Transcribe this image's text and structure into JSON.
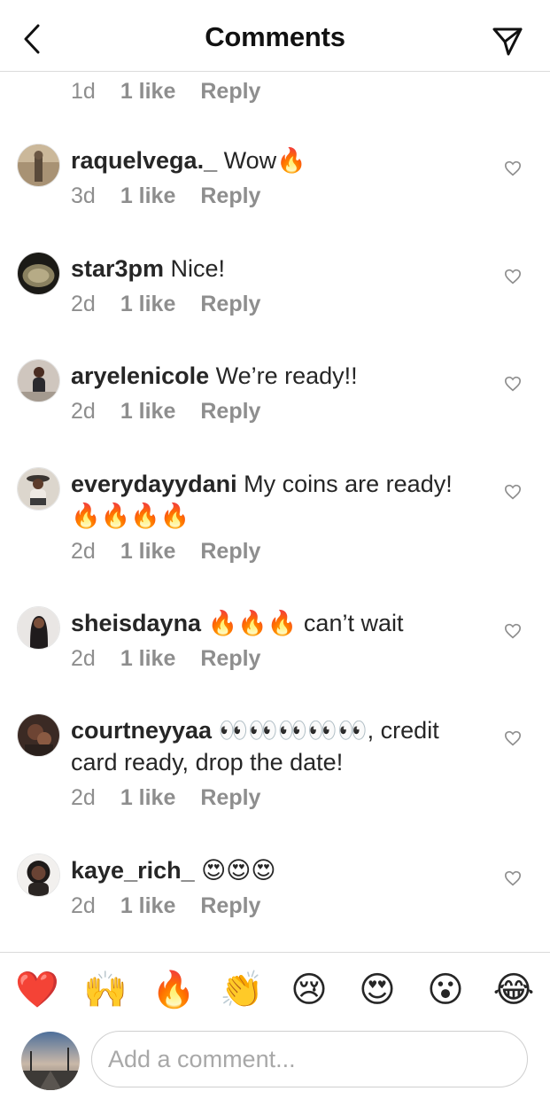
{
  "header": {
    "title": "Comments"
  },
  "top_meta": {
    "time": "1d",
    "likes": "1 like",
    "reply": "Reply"
  },
  "comments": [
    {
      "username": "raquelvega._",
      "text": " Wow🔥",
      "time": "3d",
      "likes": "1 like",
      "reply": "Reply"
    },
    {
      "username": "star3pm",
      "text": " Nice!",
      "time": "2d",
      "likes": "1 like",
      "reply": "Reply"
    },
    {
      "username": "aryelenicole",
      "text": " We’re ready!!",
      "time": "2d",
      "likes": "1 like",
      "reply": "Reply"
    },
    {
      "username": "everydayydani",
      "text": " My coins are ready! 🔥🔥🔥🔥",
      "time": "2d",
      "likes": "1 like",
      "reply": "Reply"
    },
    {
      "username": "sheisdayna",
      "text": " 🔥🔥🔥 can’t wait",
      "time": "2d",
      "likes": "1 like",
      "reply": "Reply"
    },
    {
      "username": "courtneyyaa",
      "text": " 👀👀👀👀👀, credit card ready, drop the date!",
      "time": "2d",
      "likes": "1 like",
      "reply": "Reply"
    },
    {
      "username": "kaye_rich_",
      "text": " 😍😍😍",
      "time": "2d",
      "likes": "1 like",
      "reply": "Reply"
    }
  ],
  "reactions": [
    "❤️",
    "🙌",
    "🔥",
    "👏",
    "😢",
    "😍",
    "😮",
    "😂"
  ],
  "composer": {
    "placeholder": "Add a comment..."
  },
  "icons": {
    "back": "chevron-left-icon",
    "share": "paper-plane-icon",
    "like": "heart-outline-icon"
  },
  "colors": {
    "text": "#262626",
    "muted": "#8e8e8e",
    "divider": "#dbdbdb"
  }
}
